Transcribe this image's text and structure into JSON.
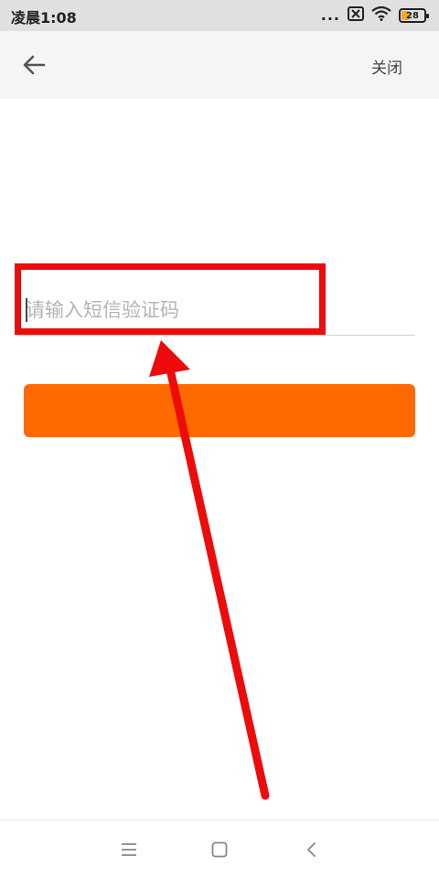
{
  "status_bar": {
    "time": "凌晨1:08",
    "dots": "...",
    "battery_level": "28"
  },
  "nav": {
    "close_label": "关闭"
  },
  "form": {
    "code_placeholder": "请输入短信验证码",
    "code_value": ""
  },
  "colors": {
    "accent": "#ff6a00",
    "annotation": "#ee0b0b"
  },
  "icons": {
    "back": "arrow-left-icon",
    "menu": "menu-icon",
    "home": "home-icon",
    "sys_back": "chevron-left-icon"
  }
}
